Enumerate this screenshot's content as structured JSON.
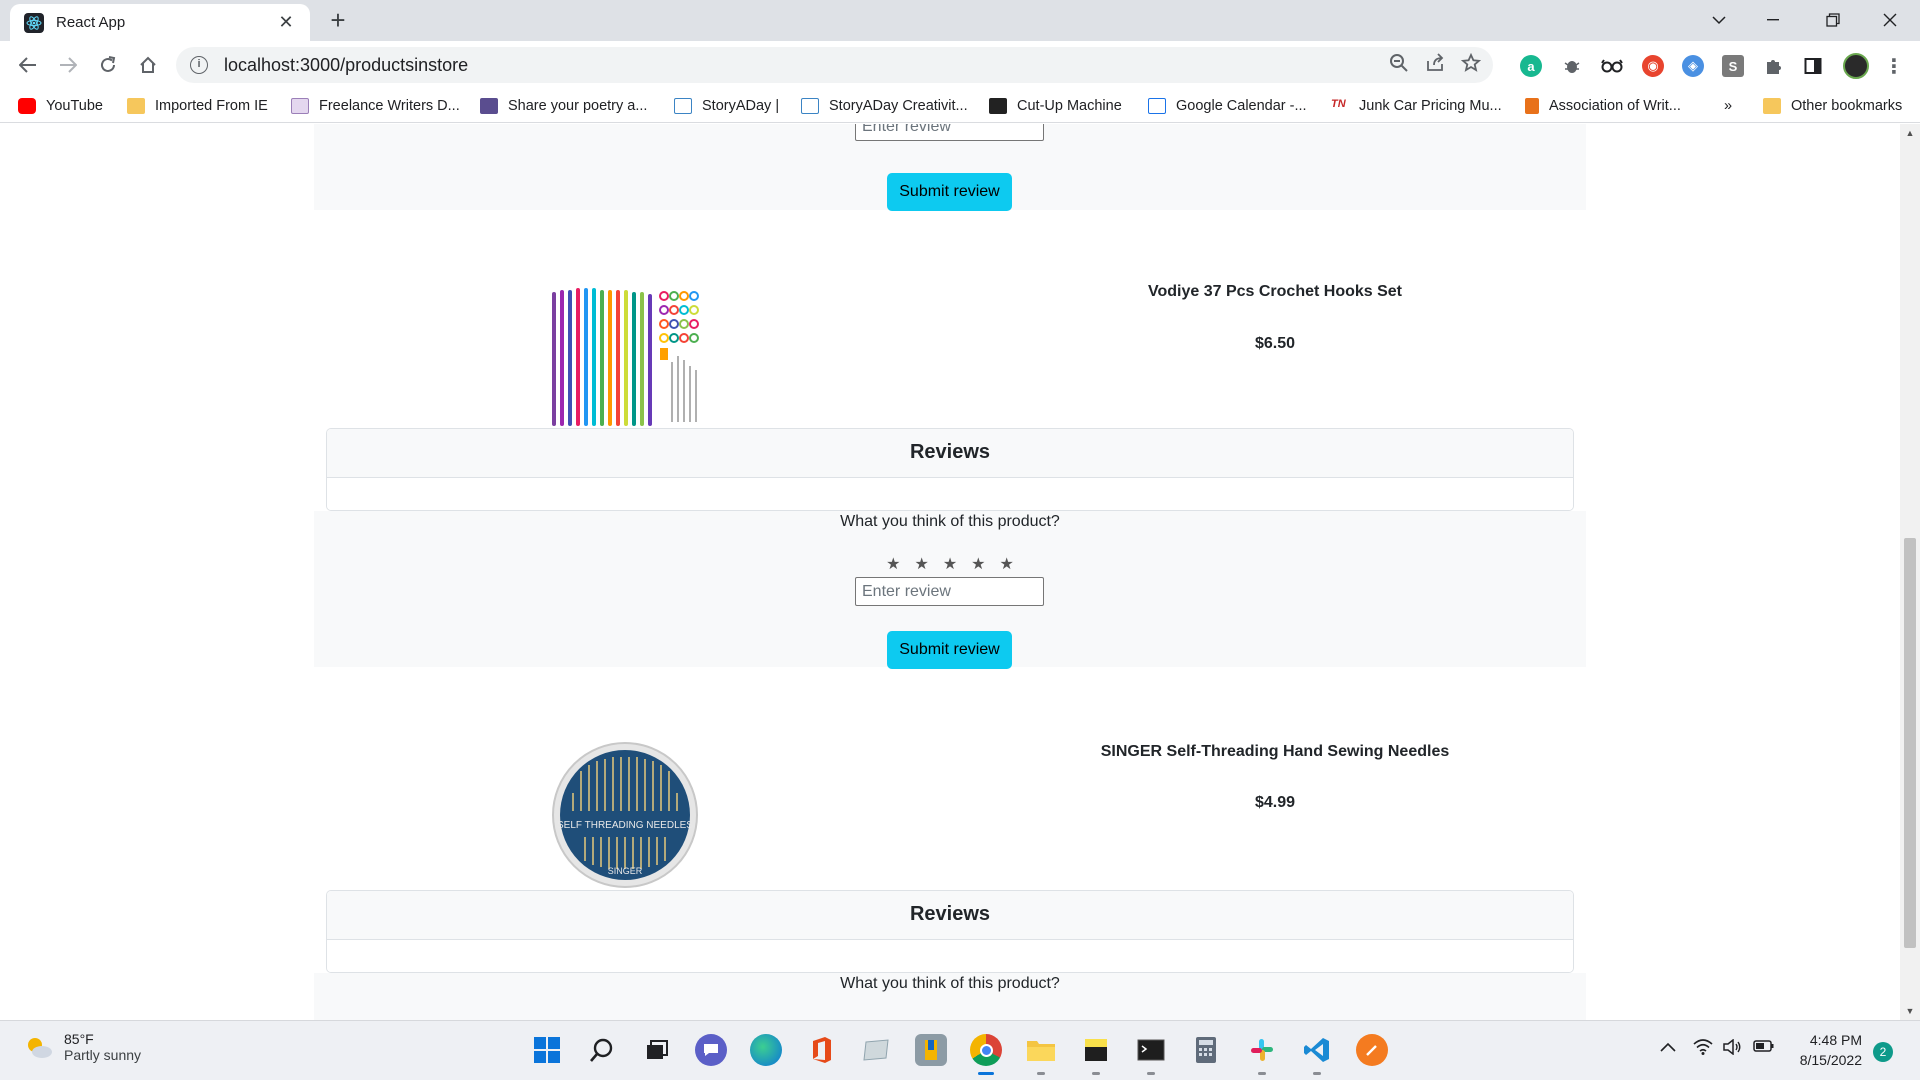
{
  "browser": {
    "tab_title": "React App",
    "url": "localhost:3000/productsinstore",
    "bookmarks": [
      {
        "label": "YouTube",
        "icon": "youtube-icon",
        "color": "#ff0000"
      },
      {
        "label": "Imported From IE",
        "icon": "folder-icon",
        "color": "#f6c75c"
      },
      {
        "label": "Freelance Writers D...",
        "icon": "d-site-icon",
        "color": "#9b7fb8"
      },
      {
        "label": "Share your poetry a...",
        "icon": "book-icon",
        "color": "#5a4d8f"
      },
      {
        "label": "StoryADay |",
        "icon": "s-site-icon",
        "color": "#3b84c4"
      },
      {
        "label": "StoryADay Creativit...",
        "icon": "s-site-icon",
        "color": "#3b84c4"
      },
      {
        "label": "Cut-Up Machine",
        "icon": "cutup-icon",
        "color": "#222222"
      },
      {
        "label": "Google Calendar -...",
        "icon": "calendar-icon",
        "color": "#1a73e8"
      },
      {
        "label": "Junk Car Pricing Mu...",
        "icon": "tn-icon",
        "color": "#c62828"
      },
      {
        "label": "Association of Writ...",
        "icon": "bookmark-doc-icon",
        "color": "#e8711a"
      }
    ],
    "overflow": "»",
    "other_bookmarks": "Other bookmarks"
  },
  "page": {
    "review_placeholder": "Enter review",
    "submit_label": "Submit review",
    "prompt": "What you think of this product?",
    "stars": "★★★★★",
    "reviews_title": "Reviews",
    "products": [
      {
        "name": "Vodiye 37 Pcs Crochet Hooks Set",
        "price": "$6.50"
      },
      {
        "name": "SINGER Self-Threading Hand Sewing Needles",
        "price": "$4.99",
        "image_text_1": "SELF THREADING NEEDLES",
        "image_text_2": "SINGER"
      }
    ]
  },
  "taskbar": {
    "weather_temp": "85°F",
    "weather_desc": "Partly sunny",
    "time": "4:48 PM",
    "date": "8/15/2022",
    "notifications": "2"
  }
}
